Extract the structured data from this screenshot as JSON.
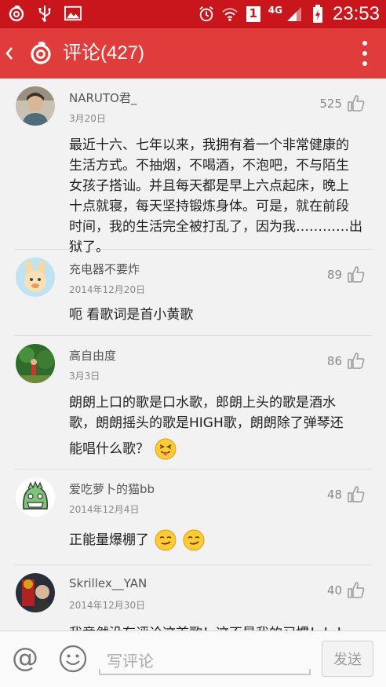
{
  "status_bar": {
    "time": "23:53",
    "network_label": "4G",
    "sim_slot": "1"
  },
  "header": {
    "title": "评论(427)"
  },
  "comments": [
    {
      "user": "NARUTO君_",
      "date": "3月20日",
      "likes": "525",
      "lines": [
        "最近十六、七年以来，我拥有着一个非常健康的",
        "生活方式。不抽烟，不喝酒，不泡吧，不与陌生",
        "女孩子搭讪。并且每天都是早上六点起床，晚上",
        "十点就寝，每天坚持锻炼身体。可是，就在前段",
        "时间，我的生活完全被打乱了，因为我…………出",
        "狱了。"
      ]
    },
    {
      "user": "充电器不要炸",
      "date": "2014年12月20日",
      "likes": "89",
      "lines": [
        "呃 看歌词是首小黄歌"
      ]
    },
    {
      "user": "高自由度",
      "date": "3月3日",
      "likes": "86",
      "lines": [
        "朗朗上口的歌是口水歌，郎朗上头的歌是酒水",
        "歌，朗朗摇头的歌是HIGH歌，朗朗除了弹琴还",
        "能唱什么歌？"
      ]
    },
    {
      "user": "爱吃萝卜的猫bb",
      "date": "2014年12月4日",
      "likes": "48",
      "lines": [
        "正能量爆棚了"
      ]
    },
    {
      "user": "Skrillex__YAN",
      "date": "2014年12月30日",
      "likes": "40",
      "lines": [
        "我竟然没有评论这首歌！这不是我的习惯！！！"
      ]
    }
  ],
  "input_bar": {
    "placeholder": "写评论",
    "send_label": "发送"
  },
  "colors": {
    "status_bar": "#c9161d",
    "app_bar": "#e03c3c",
    "background": "#f2f2f2"
  },
  "icons": {
    "status_left": [
      "netease-music-icon",
      "usb-icon",
      "image-icon"
    ],
    "status_right": [
      "alarm-icon",
      "wifi-icon",
      "sim-icon",
      "signal-icon",
      "battery-icon"
    ],
    "header": [
      "back-chevron-icon",
      "netease-music-logo-icon",
      "overflow-menu-icon"
    ],
    "comment": [
      "thumb-up-icon"
    ],
    "input": [
      "at-mention-icon",
      "emoji-icon"
    ]
  }
}
